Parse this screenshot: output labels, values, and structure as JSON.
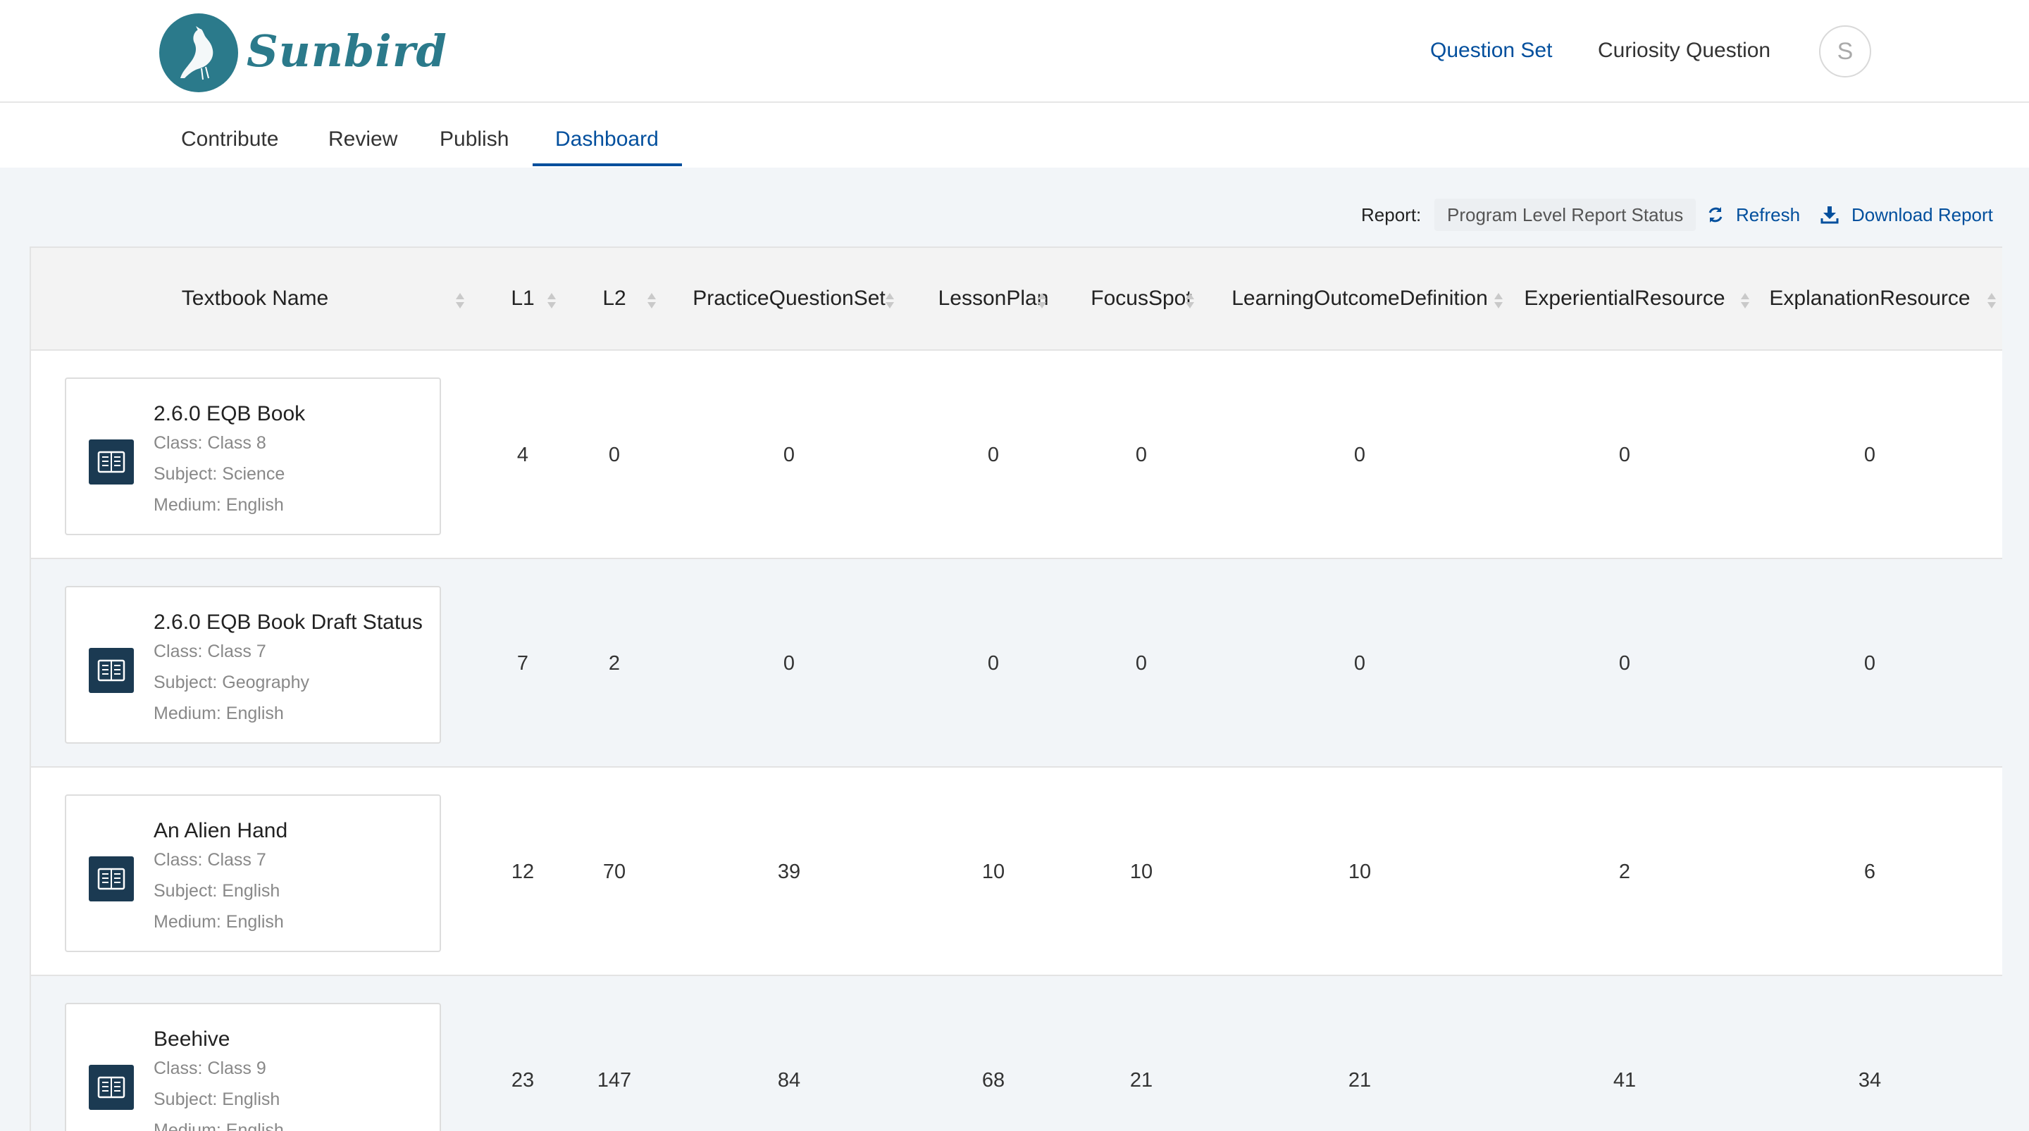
{
  "header": {
    "logo_text": "Sunbird",
    "links": [
      {
        "label": "Question Set",
        "active": true
      },
      {
        "label": "Curiosity Question",
        "active": false
      }
    ],
    "avatar_initial": "S"
  },
  "subnav": {
    "tabs": [
      {
        "label": "Contribute"
      },
      {
        "label": "Review"
      },
      {
        "label": "Publish"
      },
      {
        "label": "Dashboard"
      }
    ],
    "active_tab": "Dashboard"
  },
  "report_bar": {
    "label": "Report:",
    "selected_report": "Program Level Report Status",
    "refresh_label": "Refresh",
    "download_label": "Download Report"
  },
  "table": {
    "columns": [
      "Textbook Name",
      "L1",
      "L2",
      "PracticeQuestionSet",
      "LessonPlan",
      "FocusSpot",
      "LearningOutcomeDefinition",
      "ExperientialResource",
      "ExplanationResource"
    ],
    "rows": [
      {
        "title": "2.6.0 EQB Book",
        "class": "Class: Class 8",
        "subject": "Subject: Science",
        "medium": "Medium: English",
        "values": [
          "4",
          "0",
          "0",
          "0",
          "0",
          "0",
          "0",
          "0"
        ]
      },
      {
        "title": "2.6.0 EQB Book Draft Status",
        "class": "Class: Class 7",
        "subject": "Subject: Geography",
        "medium": "Medium: English",
        "values": [
          "7",
          "2",
          "0",
          "0",
          "0",
          "0",
          "0",
          "0"
        ]
      },
      {
        "title": "An Alien Hand",
        "class": "Class: Class 7",
        "subject": "Subject: English",
        "medium": "Medium: English",
        "values": [
          "12",
          "70",
          "39",
          "10",
          "10",
          "10",
          "2",
          "6"
        ]
      },
      {
        "title": "Beehive",
        "class": "Class: Class 9",
        "subject": "Subject: English",
        "medium": "Medium: English",
        "values": [
          "23",
          "147",
          "84",
          "68",
          "21",
          "21",
          "41",
          "34"
        ]
      }
    ]
  },
  "colors": {
    "accent": "#024f9d",
    "logo": "#2b7a8b",
    "book_icon": "#1b3a52",
    "header_bg": "#f3f3f3",
    "alt_row_bg": "#f2f5f8"
  },
  "icons": [
    "sunbird-logo-icon",
    "refresh-icon",
    "download-icon",
    "sort-icon",
    "book-icon"
  ]
}
